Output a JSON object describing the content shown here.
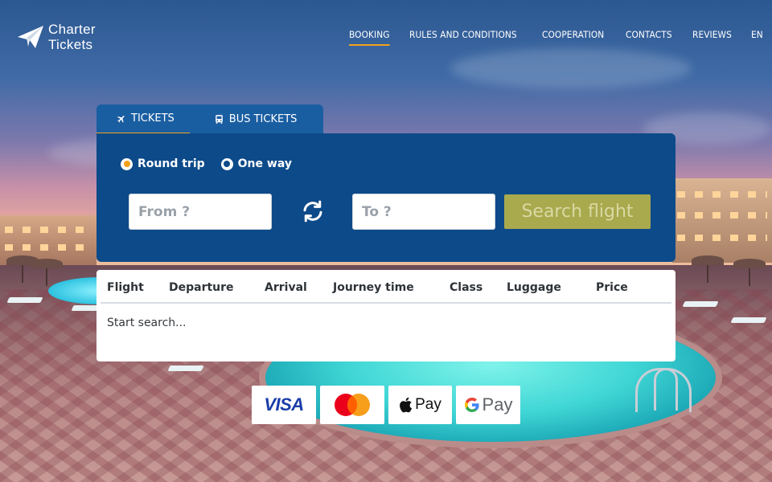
{
  "brand": {
    "line1": "Charter",
    "line2": "Tickets"
  },
  "nav": {
    "items": [
      {
        "label": "BOOKING",
        "active": true
      },
      {
        "label": "RULES AND CONDITIONS"
      },
      {
        "label": "COOPERATION"
      },
      {
        "label": "CONTACTS"
      },
      {
        "label": "REVIEWS"
      },
      {
        "label": "EN"
      }
    ]
  },
  "tabs": [
    {
      "label": "TICKETS",
      "icon": "airplane-icon",
      "active": true
    },
    {
      "label": "BUS TICKETS",
      "icon": "bus-icon"
    }
  ],
  "search": {
    "trip_types": [
      {
        "label": "Round trip",
        "checked": true
      },
      {
        "label": "One way",
        "checked": false
      }
    ],
    "from_placeholder": "From ?",
    "to_placeholder": "To ?",
    "button_label": "Search flight"
  },
  "results": {
    "columns": [
      "Flight",
      "Departure",
      "Arrival",
      "Journey time",
      "Class",
      "Luggage",
      "Price"
    ],
    "empty_text": "Start search..."
  },
  "payments": {
    "visa": "VISA",
    "apple_pay": "Pay",
    "google_pay": "Pay",
    "methods": [
      "visa",
      "mastercard",
      "apple-pay",
      "google-pay"
    ]
  },
  "colors": {
    "accent": "#f2a21b",
    "panel": "#0d4a89",
    "tab_bar": "#1a5ea2",
    "search_button": "#a9a94d"
  }
}
